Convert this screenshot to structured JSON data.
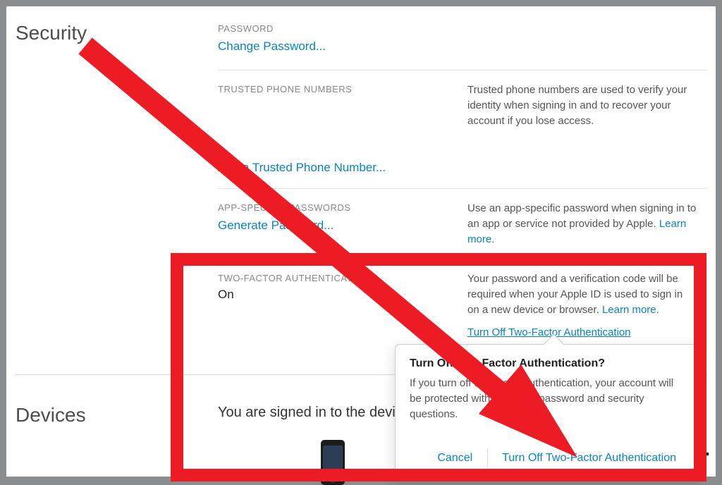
{
  "sections": {
    "security": {
      "title": "Security"
    },
    "devices": {
      "title": "Devices",
      "signed_in_text": "You are signed in to the devic"
    }
  },
  "password_row": {
    "heading": "PASSWORD",
    "link": "Change Password..."
  },
  "trusted_phone_row": {
    "heading": "TRUSTED PHONE NUMBERS",
    "link": "Add a Trusted Phone Number...",
    "desc": "Trusted phone numbers are used to verify your identity when signing in and to recover your account if you lose access."
  },
  "app_specific_row": {
    "heading": "APP-SPECIFIC PASSWORDS",
    "link": "Generate Password...",
    "desc": "Use an app-specific password when signing in to an app or service not provided by Apple.",
    "learn_more": "Learn more."
  },
  "two_factor_row": {
    "heading": "TWO-FACTOR AUTHENTICATION",
    "value": "On",
    "desc": "Your password and a verification code will be required when your Apple ID is used to sign in on a new device or browser. ",
    "learn_more": "Learn more.",
    "turn_off_link": "Turn Off Two-Factor Authentication"
  },
  "popover": {
    "title": "Turn Off Two-Factor Authentication?",
    "body": "If you turn off two-factor authentication, your account will be protected with only your password and security questions.",
    "cancel": "Cancel",
    "confirm": "Turn Off Two-Factor Authentication"
  },
  "colors": {
    "link": "#0a84c1",
    "annotation": "#ed1c24"
  }
}
